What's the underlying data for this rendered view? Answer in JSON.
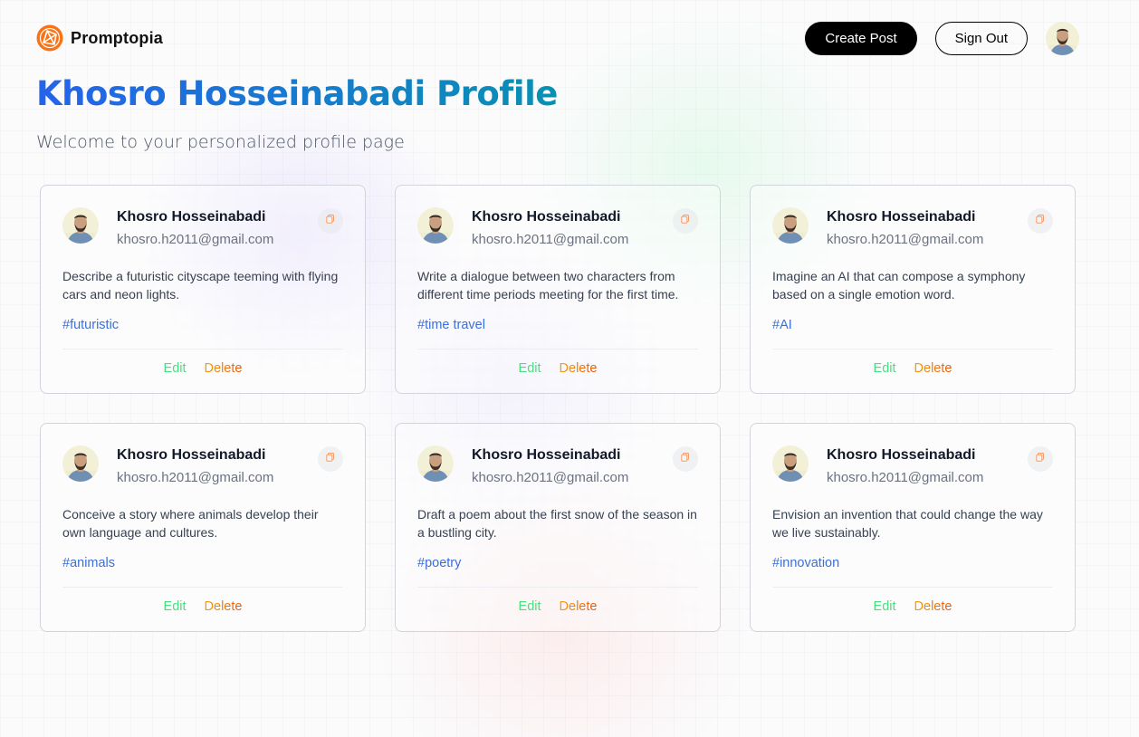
{
  "nav": {
    "brand": "Promptopia",
    "create_post": "Create Post",
    "sign_out": "Sign Out"
  },
  "profile": {
    "title": "Khosro Hosseinabadi Profile",
    "description": "Welcome to your personalized profile page"
  },
  "posts": [
    {
      "name": "Khosro Hosseinabadi",
      "email": "khosro.h2011@gmail.com",
      "prompt": "Describe a futuristic cityscape teeming with flying cars and neon lights.",
      "tag": "#futuristic",
      "edit": "Edit",
      "delete": "Delete"
    },
    {
      "name": "Khosro Hosseinabadi",
      "email": "khosro.h2011@gmail.com",
      "prompt": "Write a dialogue between two characters from different time periods meeting for the first time.",
      "tag": "#time travel",
      "edit": "Edit",
      "delete": "Delete"
    },
    {
      "name": "Khosro Hosseinabadi",
      "email": "khosro.h2011@gmail.com",
      "prompt": "Imagine an AI that can compose a symphony based on a single emotion word.",
      "tag": "#AI",
      "edit": "Edit",
      "delete": "Delete"
    },
    {
      "name": "Khosro Hosseinabadi",
      "email": "khosro.h2011@gmail.com",
      "prompt": "Conceive a story where animals develop their own language and cultures.",
      "tag": "#animals",
      "edit": "Edit",
      "delete": "Delete"
    },
    {
      "name": "Khosro Hosseinabadi",
      "email": "khosro.h2011@gmail.com",
      "prompt": "Draft a poem about the first snow of the season in a bustling city.",
      "tag": "#poetry",
      "edit": "Edit",
      "delete": "Delete"
    },
    {
      "name": "Khosro Hosseinabadi",
      "email": "khosro.h2011@gmail.com",
      "prompt": "Envision an invention that could change the way we live sustainably.",
      "tag": "#innovation",
      "edit": "Edit",
      "delete": "Delete"
    }
  ],
  "colors": {
    "title_gradient_start": "#2563eb",
    "title_gradient_end": "#0891b2",
    "brand_orange": "#f97316",
    "edit_green": "#4ade80",
    "tag_blue": "#3b6fd8"
  },
  "icons": {
    "logo": "promptopia-logo-icon",
    "copy": "copy-icon",
    "avatar": "user-avatar"
  }
}
